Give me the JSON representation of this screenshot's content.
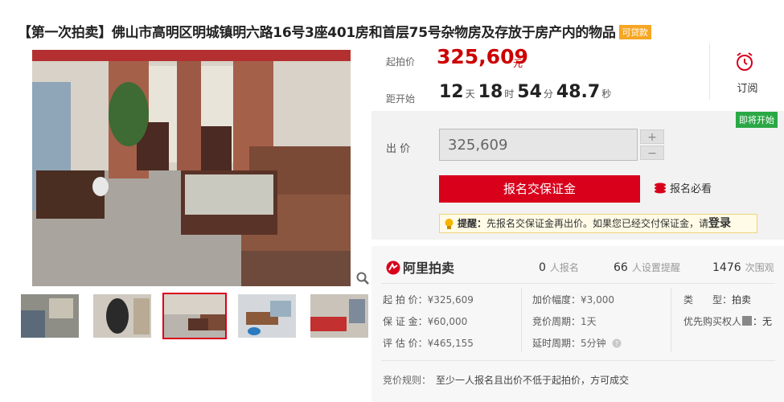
{
  "title": {
    "text": "【第一次拍卖】佛山市高明区明城镇明六路16号3座401房和首层75号杂物房及存放于房产内的物品",
    "tag": "可贷款"
  },
  "gallery": {
    "zoom_icon": "magnifier-icon",
    "active_index": 2
  },
  "price": {
    "start_label": "起拍价",
    "start_value": "325,609",
    "unit": "元",
    "countdown_label": "距开始",
    "days": "12",
    "days_u": "天",
    "hours": "18",
    "hours_u": "时",
    "mins": "54",
    "mins_u": "分",
    "secs": "48.7",
    "secs_u": "秒"
  },
  "subscribe": {
    "icon": "alarm-clock-icon",
    "label": "订阅"
  },
  "bid": {
    "badge": "即将开始",
    "label": "出 价",
    "value": "325,609",
    "plus": "+",
    "minus": "−",
    "register_button": "报名交保证金",
    "must_read": "报名必看",
    "tip_title": "提醒：",
    "tip_text": "先报名交保证金再出价。如果您已经交付保证金，请",
    "tip_login": "登录"
  },
  "platform": {
    "logo_text": "阿里拍卖",
    "logo_icon": "ali-auction-logo"
  },
  "stats": [
    {
      "count": "0",
      "label": "人报名"
    },
    {
      "count": "66",
      "label": "人设置提醒"
    },
    {
      "count": "1476",
      "label": "次围观"
    }
  ],
  "details": {
    "start_price": {
      "k": "起 拍 价：",
      "v": "¥325,609"
    },
    "deposit": {
      "k": "保 证 金：",
      "v": "¥60,000"
    },
    "appraisal": {
      "k": "评 估 价：",
      "v": "¥465,155"
    },
    "increment": {
      "k": "加价幅度：",
      "v": "¥3,000"
    },
    "cycle": {
      "k": "竞价周期：",
      "v": "1天"
    },
    "delay": {
      "k": "延时周期：",
      "v": "5分钟"
    },
    "type": {
      "k": "类　　型：",
      "v": "拍卖"
    },
    "priority": {
      "k": "优先购买权人",
      "v": "：无"
    }
  },
  "rule": {
    "k": "竞价规则：",
    "v": "至少一人报名且出价不低于起拍价，方可成交"
  },
  "colors": {
    "accent_red": "#d9001b",
    "price_red": "#cc0000",
    "badge_green": "#2aa845",
    "tag_orange": "#f5a623"
  }
}
